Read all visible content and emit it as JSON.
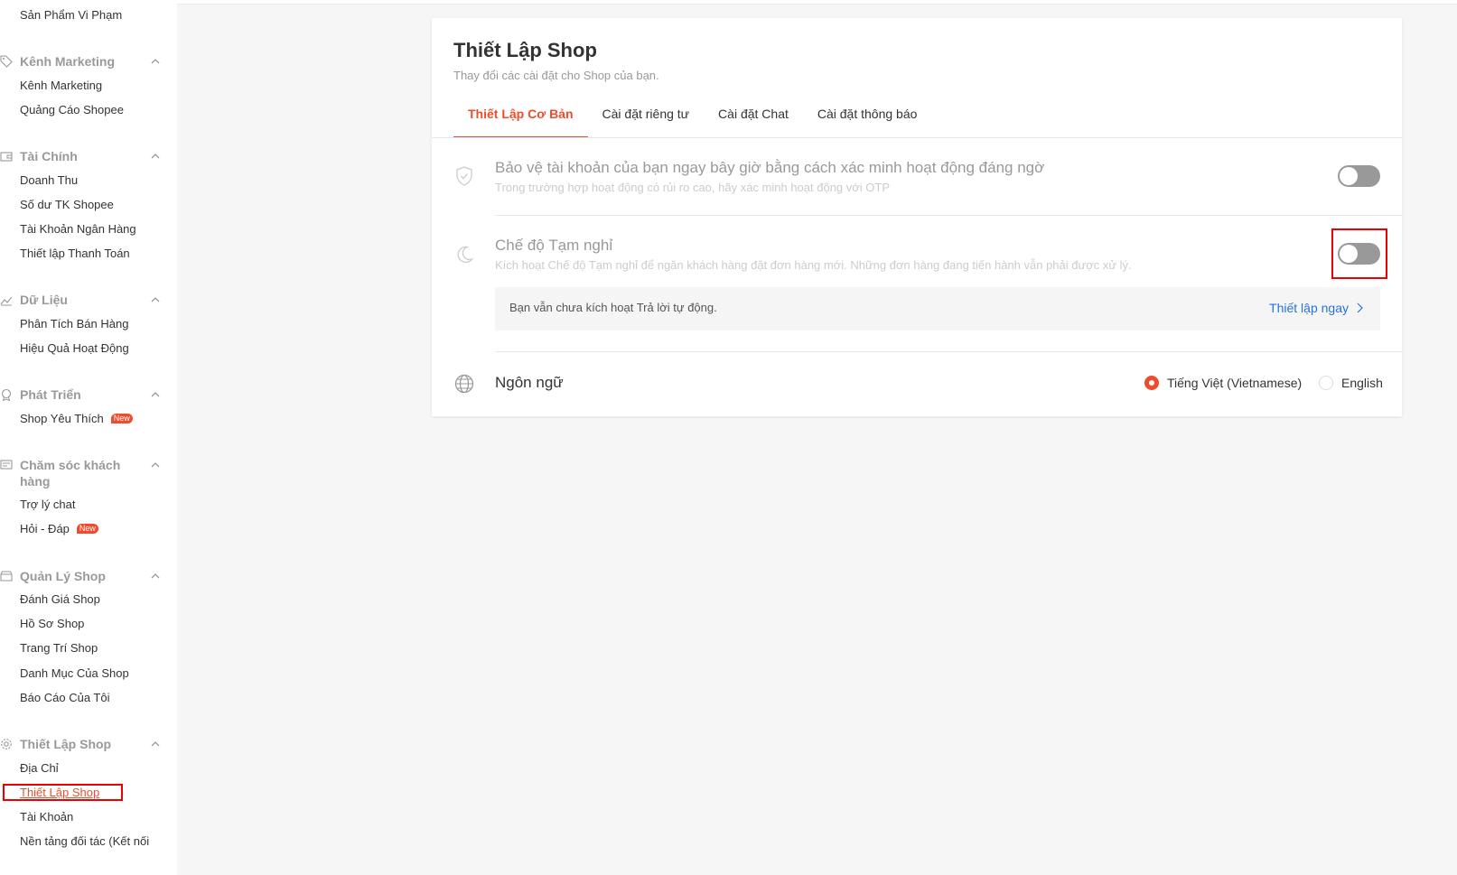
{
  "sidebar": {
    "top_item": "Sản Phẩm Vi Phạm",
    "groups": [
      {
        "title": "Kênh Marketing",
        "icon": "tag-icon",
        "items": [
          {
            "label": "Kênh Marketing"
          },
          {
            "label": "Quảng Cáo Shopee"
          }
        ]
      },
      {
        "title": "Tài Chính",
        "icon": "wallet-icon",
        "items": [
          {
            "label": "Doanh Thu"
          },
          {
            "label": "Số dư TK Shopee"
          },
          {
            "label": "Tài Khoản Ngân Hàng"
          },
          {
            "label": "Thiết lập Thanh Toán"
          }
        ]
      },
      {
        "title": "Dữ Liệu",
        "icon": "chart-line-icon",
        "items": [
          {
            "label": "Phân Tích Bán Hàng"
          },
          {
            "label": "Hiệu Quả Hoạt Động"
          }
        ]
      },
      {
        "title": "Phát Triển",
        "icon": "medal-icon",
        "items": [
          {
            "label": "Shop Yêu Thích",
            "badge": "New"
          }
        ]
      },
      {
        "title": "Chăm sóc khách hàng",
        "icon": "chat-icon",
        "items": [
          {
            "label": "Trợ lý chat"
          },
          {
            "label": "Hỏi - Đáp",
            "badge": "New"
          }
        ]
      },
      {
        "title": "Quản Lý Shop",
        "icon": "shop-icon",
        "items": [
          {
            "label": "Đánh Giá Shop"
          },
          {
            "label": "Hồ Sơ Shop"
          },
          {
            "label": "Trang Trí Shop"
          },
          {
            "label": "Danh Mục Của Shop"
          },
          {
            "label": "Báo Cáo Của Tôi"
          }
        ]
      },
      {
        "title": "Thiết Lập Shop",
        "icon": "gear-icon",
        "items": [
          {
            "label": "Địa Chỉ"
          },
          {
            "label": "Thiết Lập Shop",
            "active": true
          },
          {
            "label": "Tài Khoản"
          },
          {
            "label": "Nền tảng đối tác (Kết nối"
          }
        ]
      }
    ]
  },
  "page": {
    "title": "Thiết Lập Shop",
    "subtitle": "Thay đổi các cài đặt cho Shop của bạn.",
    "tabs": [
      {
        "label": "Thiết Lập Cơ Bản",
        "active": true
      },
      {
        "label": "Cài đặt riêng tư"
      },
      {
        "label": "Cài đặt Chat"
      },
      {
        "label": "Cài đặt thông báo"
      }
    ]
  },
  "settings": {
    "protect": {
      "title": "Bảo vệ tài khoản của bạn ngay bây giờ bằng cách xác minh hoạt động đáng ngờ",
      "desc": "Trong trường hợp hoạt động có rủi ro cao, hãy xác minh hoạt động với OTP",
      "enabled": false,
      "icon": "shield-icon"
    },
    "vacation": {
      "title": "Chế độ Tạm nghỉ",
      "desc": "Kích hoạt Chế độ Tạm nghỉ để ngăn khách hàng đặt đơn hàng mới. Những đơn hàng đang tiến hành vẫn phải được xử lý.",
      "enabled": false,
      "icon": "moon-icon",
      "notice": "Bạn vẫn chưa kích hoạt Trả lời tự động.",
      "notice_link": "Thiết lập ngay"
    },
    "language": {
      "title": "Ngôn ngữ",
      "icon": "globe-icon",
      "options": [
        {
          "label": "Tiếng Việt (Vietnamese)",
          "selected": true
        },
        {
          "label": "English",
          "selected": false
        }
      ]
    }
  },
  "colors": {
    "accent": "#ee4d2d",
    "link": "#2673dd",
    "highlight": "#ee0000"
  }
}
